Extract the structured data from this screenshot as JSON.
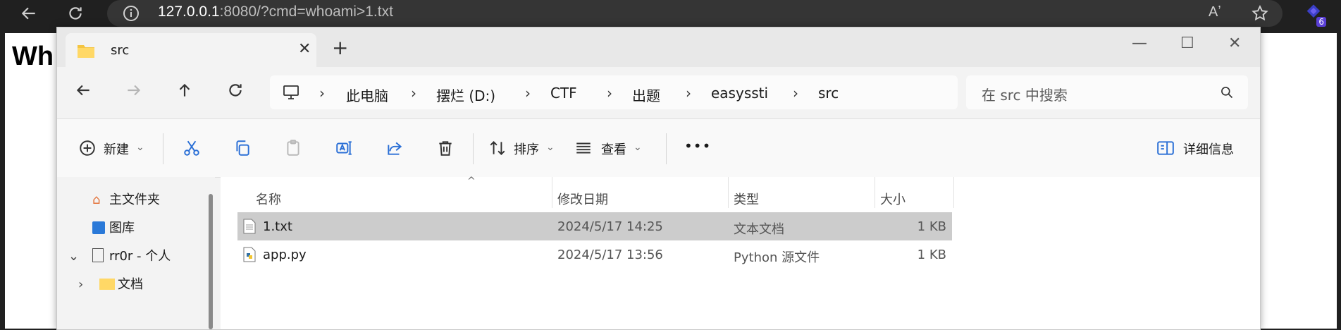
{
  "browser": {
    "url_host": "127.0.0.1",
    "url_rest": ":8080/?cmd=whoami>1.txt",
    "read_aloud": "Aʼ",
    "extension_badge": "6"
  },
  "page": {
    "heading": "Wh"
  },
  "explorer": {
    "tab_title": "src",
    "breadcrumb": [
      "此电脑",
      "摆烂 (D:)",
      "CTF",
      "出题",
      "easyssti",
      "src"
    ],
    "search_placeholder": "在 src 中搜索",
    "commands": {
      "new": "新建",
      "sort": "排序",
      "view": "查看",
      "more": "•••",
      "details": "详细信息"
    },
    "sidebar": [
      {
        "label": "主文件夹",
        "icon": "home-icon"
      },
      {
        "label": "图库",
        "icon": "gallery-icon"
      },
      {
        "label": "rr0r - 个人",
        "icon": "file-icon"
      },
      {
        "label": "文档",
        "icon": "folder-icon"
      }
    ],
    "columns": {
      "name": "名称",
      "modified": "修改日期",
      "type": "类型",
      "size": "大小"
    },
    "files": [
      {
        "name": "1.txt",
        "modified": "2024/5/17 14:25",
        "type": "文本文档",
        "size": "1 KB",
        "selected": true,
        "icon": "text-file-icon"
      },
      {
        "name": "app.py",
        "modified": "2024/5/17 13:56",
        "type": "Python 源文件",
        "size": "1 KB",
        "selected": false,
        "icon": "python-file-icon"
      }
    ]
  }
}
